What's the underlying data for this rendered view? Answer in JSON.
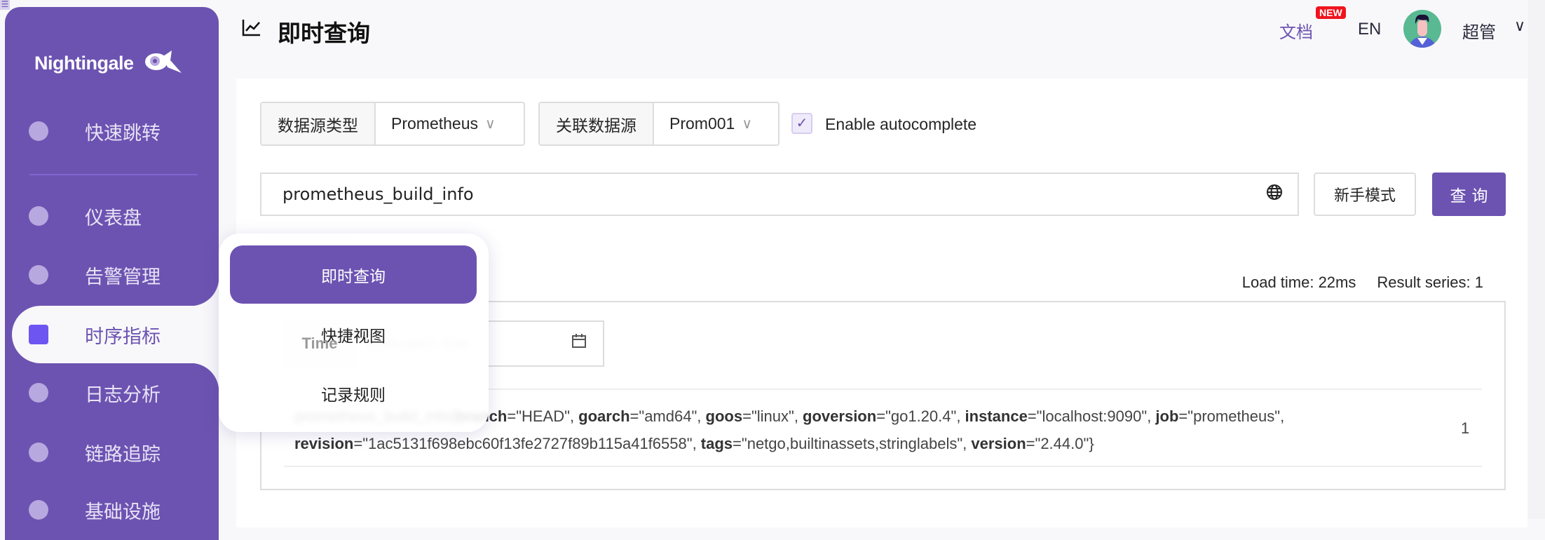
{
  "brand": {
    "name": "Nightingale",
    "accent": "#6c53b1"
  },
  "sidebar": {
    "items": [
      {
        "label": "快速跳转",
        "icon": "search-icon"
      },
      {
        "label": "仪表盘",
        "icon": "dashboard-icon"
      },
      {
        "label": "告警管理",
        "icon": "alarm-icon"
      },
      {
        "label": "时序指标",
        "icon": "metrics-icon",
        "active": true
      },
      {
        "label": "日志分析",
        "icon": "log-icon"
      },
      {
        "label": "链路追踪",
        "icon": "link-icon"
      },
      {
        "label": "基础设施",
        "icon": "infra-icon"
      }
    ]
  },
  "header": {
    "title": "即时查询",
    "docs": "文档",
    "new_badge": "NEW",
    "lang": "EN",
    "user": "超管"
  },
  "query": {
    "ds_type_label": "数据源类型",
    "ds_type_value": "Prometheus",
    "ds_label": "关联数据源",
    "ds_value": "Prom001",
    "autocomplete_label": "Enable autocomplete",
    "autocomplete_checked": true,
    "expression": "prometheus_build_info",
    "beginner_button": "新手模式",
    "query_button": "查询"
  },
  "stats": {
    "load_time": "Load time: 22ms",
    "result_series": "Result series: 1"
  },
  "result": {
    "time_label": "Time",
    "time_placeholder": "Evaluation time",
    "metric": "prometheus_build_info",
    "labels": [
      {
        "k": "branch",
        "v": "\"HEAD\""
      },
      {
        "k": "goarch",
        "v": "\"amd64\""
      },
      {
        "k": "goos",
        "v": "\"linux\""
      },
      {
        "k": "goversion",
        "v": "\"go1.20.4\""
      },
      {
        "k": "instance",
        "v": "\"localhost:9090\""
      },
      {
        "k": "job",
        "v": "\"prometheus\""
      },
      {
        "k": "revision",
        "v": "\"1ac5131f698ebc60f13fe2727f89b115a41f6558\""
      },
      {
        "k": "tags",
        "v": "\"netgo,builtinassets,stringlabels\""
      },
      {
        "k": "version",
        "v": "\"2.44.0\""
      }
    ],
    "value": "1"
  },
  "popover": {
    "items": [
      "即时查询",
      "快捷视图",
      "记录规则"
    ],
    "active": 0
  }
}
